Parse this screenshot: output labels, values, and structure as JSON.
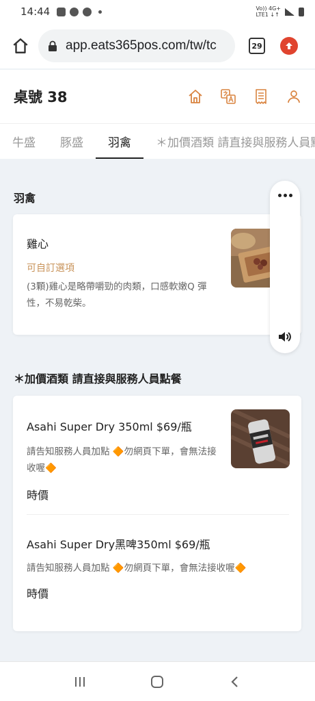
{
  "status_bar": {
    "time": "14:44",
    "icons": [
      "photo-icon",
      "chrome-icon",
      "chrome-icon",
      "dot-icon"
    ],
    "network_label": "Vo)) 4G+\nLTE1 ↓↑",
    "right_icons": [
      "signal-icon",
      "battery-icon"
    ]
  },
  "browser": {
    "url": "app.eats365pos.com/tw/tc",
    "tabs_count": "29"
  },
  "header": {
    "table_title": "桌號 38",
    "icons": [
      "home-icon",
      "translate-icon",
      "receipt-icon",
      "user-icon"
    ]
  },
  "category_tabs": [
    {
      "label": "牛盛",
      "active": false
    },
    {
      "label": "豚盛",
      "active": false
    },
    {
      "label": "羽禽",
      "active": true
    },
    {
      "label": "＊加價酒類 請直接與服務人員點餐",
      "active": false
    }
  ],
  "sections": [
    {
      "title": "羽禽",
      "items": [
        {
          "name": "雞心",
          "subtitle": "可自訂選項",
          "description": "(3顆)雞心是略帶嚼勁的肉類，口感軟嫩Q 彈性，不易乾柴。",
          "price": ""
        }
      ]
    },
    {
      "title": "＊加價酒類 請直接與服務人員點餐",
      "items": [
        {
          "name": "Asahi Super Dry 350ml $69/瓶",
          "description": "請告知服務人員加點 🔶勿網頁下單，會無法接收喔🔶",
          "price": "時價"
        },
        {
          "name": "Asahi Super Dry黑啤350ml $69/瓶",
          "description": "請告知服務人員加點 🔶勿網頁下單，會無法接收喔🔶",
          "price": "時價"
        }
      ]
    }
  ],
  "colors": {
    "accent": "#c8935a",
    "icon_orange": "#d9833f",
    "update_red": "#e0442f",
    "background": "#eef2f6"
  }
}
